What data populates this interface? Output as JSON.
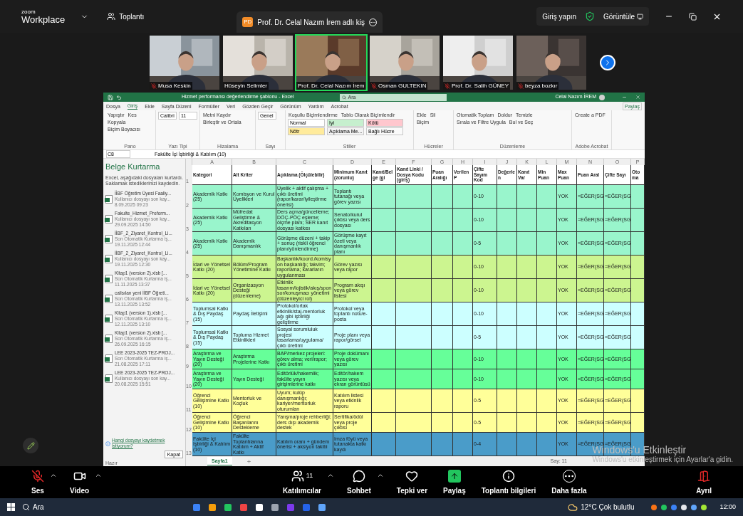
{
  "topbar": {
    "logo_top": "zoom",
    "logo_bottom": "Workplace",
    "meeting_menu": "Toplantı",
    "meeting_tab": {
      "badge": "PD",
      "title": "Prof. Dr. Celal Nazım İrem adlı kiş"
    },
    "sign_in": "Giriş yapın",
    "view": "Görüntüle"
  },
  "participants": [
    {
      "name": "Musa Keskin",
      "muted": true,
      "selected": false
    },
    {
      "name": "Hüseyin Selimler",
      "muted": false,
      "selected": false
    },
    {
      "name": "Prof. Dr. Celal Nazım İrem",
      "muted": false,
      "selected": true
    },
    {
      "name": "Osman GULTEKIN",
      "muted": true,
      "selected": false
    },
    {
      "name": "Prof. Dr. Salih GÜNEY",
      "muted": true,
      "selected": false
    },
    {
      "name": "beyza bozkır",
      "muted": true,
      "selected": false
    }
  ],
  "excel": {
    "title": "Hizmet performansı değerlendirme şablonu - Excel",
    "search": "Ara",
    "user": "Celal Nazım İREM",
    "tabs": [
      {
        "label": "Dosya",
        "selected": false
      },
      {
        "label": "Giriş",
        "selected": true
      },
      {
        "label": "Ekle",
        "selected": false
      },
      {
        "label": "Sayfa Düzeni",
        "selected": false
      },
      {
        "label": "Formüller",
        "selected": false
      },
      {
        "label": "Veri",
        "selected": false
      },
      {
        "label": "Gözden Geçir",
        "selected": false
      },
      {
        "label": "Görünüm",
        "selected": false
      },
      {
        "label": "Yardım",
        "selected": false
      },
      {
        "label": "Acrobat",
        "selected": false
      }
    ],
    "share": "Paylaş",
    "ribbon_groups": [
      {
        "name": "Pano",
        "items": [
          {
            "kind": "button",
            "label": "Yapıştır"
          },
          {
            "kind": "button",
            "label": "Kes"
          },
          {
            "kind": "button",
            "label": "Kopyala"
          },
          {
            "kind": "button",
            "label": "Biçim Boyacısı"
          }
        ]
      },
      {
        "name": "Yazı Tipi",
        "items": [
          {
            "kind": "field",
            "label": "Calibri"
          },
          {
            "kind": "field",
            "label": "11"
          }
        ]
      },
      {
        "name": "Hizalama",
        "items": [
          {
            "kind": "button",
            "label": "Metni Kaydır"
          },
          {
            "kind": "button",
            "label": "Birleştir ve Ortala"
          }
        ]
      },
      {
        "name": "Sayı",
        "items": [
          {
            "kind": "field",
            "label": "Genel"
          }
        ]
      },
      {
        "name": "Stiller",
        "items": [
          {
            "kind": "button",
            "label": "Koşullu Biçimlendirme"
          },
          {
            "kind": "button",
            "label": "Tablo Olarak Biçimlendir"
          },
          {
            "kind": "style",
            "label": "Normal",
            "color": "#ffffff"
          },
          {
            "kind": "style",
            "label": "İyi",
            "color": "#c6efce"
          },
          {
            "kind": "style",
            "label": "Kötü",
            "color": "#ffc7ce"
          },
          {
            "kind": "style",
            "label": "Nötr",
            "color": "#ffeb9c"
          },
          {
            "kind": "style",
            "label": "Açıklama Me...",
            "color": "#f2f2f2"
          },
          {
            "kind": "style",
            "label": "Bağlı Hücre",
            "color": "#fafafa"
          }
        ]
      },
      {
        "name": "Hücreler",
        "items": [
          {
            "kind": "button",
            "label": "Ekle"
          },
          {
            "kind": "button",
            "label": "Sil"
          },
          {
            "kind": "button",
            "label": "Biçim"
          }
        ]
      },
      {
        "name": "Düzenleme",
        "items": [
          {
            "kind": "button",
            "label": "Otomatik Toplam"
          },
          {
            "kind": "button",
            "label": "Doldur"
          },
          {
            "kind": "button",
            "label": "Temizle"
          },
          {
            "kind": "button",
            "label": "Sırala ve Filtre Uygula"
          },
          {
            "kind": "button",
            "label": "Bul ve Seç"
          }
        ]
      },
      {
        "name": "Adobe Acrobat",
        "items": [
          {
            "kind": "button",
            "label": "Create a PDF"
          }
        ]
      }
    ],
    "name_box": "C8",
    "formula": "Fakülte İçi İşbirliği & Katılım (10)",
    "recovery": {
      "title": "Belge Kurtarma",
      "intro": "Excel, aşağıdaki dosyaları kurtardı. Saklamak istediklerinizi kaydedin.",
      "files": [
        {
          "name": "İİBF Öğretim Üyesi Faaliy...",
          "status": "Kullanıcı dosyayı son kay...",
          "date": "8.09.2025 09:23"
        },
        {
          "name": "Fakulte_Hizmet_Preform...",
          "status": "Kullanıcı dosyayı son kay...",
          "date": "29.09.2025 14:50"
        },
        {
          "name": "İİBF_2_Ziyaret_Kontrol_Li...",
          "status": "Son Otomatik Kurtarma iş...",
          "date": "19.11.2025 12:44"
        },
        {
          "name": "İİBF_2_Ziyaret_Kontrol_Li...",
          "status": "Kullanıcı dosyayı son kay...",
          "date": "19.11.2025 12:30"
        },
        {
          "name": "Kitap1 (version 2).xlsb [...",
          "status": "Son Otomatik Kurtarma iş...",
          "date": "11.11.2025 13:37"
        },
        {
          "name": "calisılan yeni İİBF Öğreti...",
          "status": "Son Otomatik Kurtarma iş...",
          "date": "13.11.2025 13:52"
        },
        {
          "name": "Kitap1 (version 1).xlsb [...",
          "status": "Son Otomatik Kurtarma iş...",
          "date": "12.11.2025 13:10"
        },
        {
          "name": "Kitap1 (version 2).xlsb [...",
          "status": "Son Otomatik Kurtarma iş...",
          "date": "26.09.2025 16:15"
        },
        {
          "name": "LEE 2023-2025 TEZ-PROJ...",
          "status": "Son Otomatik Kurtarma iş...",
          "date": "21.08.2025 17:11"
        },
        {
          "name": "LEE 2023-2025 TEZ-PROJ...",
          "status": "Kullanıcı dosyayı son kay...",
          "date": "20.08.2025 15:51"
        }
      ],
      "link": "Hangi dosyayı kaydetmek istiyorum?",
      "close": "Kapat"
    },
    "column_letters": [
      "A",
      "B",
      "C",
      "D",
      "E",
      "F",
      "G",
      "H",
      "I",
      "J",
      "K",
      "L",
      "M",
      "N",
      "O",
      "P"
    ],
    "header": {
      "row_number": "1",
      "cells": [
        "Kategori",
        "Alt Kriter",
        "Açıklama (Ölçülebilir)",
        "Minimum Kanıt (zorunlu)",
        "Kanıt/Belge (gi",
        "Kanıt Linki / Dosya Kodu (giriş)",
        "Puan Aralığı",
        "Verilen P",
        "Çifte Sayım Kod",
        "Değerlen",
        "Kanıt Var",
        "Min Puan",
        "Max Puan",
        "Puan Aral",
        "Çifte Sayı",
        "Otoma"
      ]
    },
    "rows": [
      {
        "row_number": "2",
        "color": "#99f5cc",
        "category": "Akademik Katkı (25)",
        "criterion": "Komisyon ve Kurul Üyelikleri",
        "description": "Üyelik + aktif çalışma + çıktı üretimi (rapor/karar/iyileştirme önerisi)",
        "evidence": "Toplantı tutanağı veya görev yazısı",
        "range": "0-10",
        "max": "YOK",
        "formula_n": "=EĞER(SG",
        "formula_o": "=EĞER(SG"
      },
      {
        "row_number": "3",
        "color": "#99f5cc",
        "category": "Akademik Katkı (25)",
        "criterion": "Müfredat Geliştirme & Akreditasyon Katkıları",
        "description": "Ders açma/güncelleme; DÖÇ-PÖÇ eşleme; ölçme planı; SER kanıt dosyası katkısı",
        "evidence": "Senato/kurul çıktısı veya ders dosyası",
        "range": "0-10",
        "max": "YOK",
        "formula_n": "=EĞER(SG",
        "formula_o": "=EĞER(SG"
      },
      {
        "row_number": "4",
        "color": "#99f5cc",
        "category": "Akademik Katkı (25)",
        "criterion": "Akademik Danışmanlık",
        "description": "Görüşme düzeni + takip + sonuç (riskli öğrenci planı/yönlendirme)",
        "evidence": "Görüşme kayıt özeti veya danışmanlık planı",
        "range": "0-5",
        "max": "YOK",
        "formula_n": "=EĞER(SG",
        "formula_o": "=EĞER(SG"
      },
      {
        "row_number": "5",
        "color": "#ccf590",
        "category": "İdari ve Yönetsel Katkı (20)",
        "criterion": "Bölüm/Program Yönetimine Katkı",
        "description": "Başkanlık/koord./komisyon başkanlığı; takvim; raporlama; kararların uygulanması",
        "evidence": "Görev yazısı veya rapor",
        "range": "0-10",
        "max": "YOK",
        "formula_n": "=EĞER(SG",
        "formula_o": "=EĞER(SG"
      },
      {
        "row_number": "6",
        "color": "#ccf590",
        "category": "İdari ve Yönetsel Katkı (20)",
        "criterion": "Organizasyon Desteği (düzenleme)",
        "description": "Etkinlik tasarım/lojistik/akış/sponsor/konuşmacı yönetimi (düzenleyici rol)",
        "evidence": "Program akışı veya görev listesi",
        "range": "0-10",
        "max": "YOK",
        "formula_n": "=EĞER(SG",
        "formula_o": "=EĞER(SG"
      },
      {
        "row_number": "7",
        "color": "#ccffff",
        "category": "Toplumsal Katkı & Dış Paydaş (15)",
        "criterion": "Paydaş İletişimi",
        "description": "Protokol/ortak etkinlik/staj-mentorluk ağı gibi işbirliği geliştirme",
        "evidence": "Protokol veya toplantı notu/e-posta",
        "range": "0-10",
        "max": "YOK",
        "formula_n": "=EĞER(SG",
        "formula_o": "=EĞER(SG"
      },
      {
        "row_number": "8",
        "color": "#ccffff",
        "category": "Toplumsal Katkı & Dış Paydaş (15)",
        "criterion": "Topluma Hizmet Etkinlikleri",
        "description": "Sosyal sorumluluk projesi tasarlama/uygulama/çıktı üretimi",
        "evidence": "Proje planı veya rapor/görsel",
        "range": "0-5",
        "max": "YOK",
        "formula_n": "=EĞER(SG",
        "formula_o": "=EĞER(SG"
      },
      {
        "row_number": "9",
        "color": "#66ff99",
        "category": "Araştırma ve Yayın Desteği (20)",
        "criterion": "Araştırma Projelerine Katkı",
        "description": "BAP/merkez projeleri: görev alma; veri/rapor; çıktı üretimi",
        "evidence": "Proje dokümanı veya görev yazısı",
        "range": "0-10",
        "max": "YOK",
        "formula_n": "=EĞER(SG",
        "formula_o": "=EĞER(SG"
      },
      {
        "row_number": "10",
        "color": "#66ff99",
        "category": "Araştırma ve Yayın Desteği (20)",
        "criterion": "Yayın Desteği",
        "description": "Editörlük/hakemlik; fakülte yayın girişimlerine katkı",
        "evidence": "Editör/hakem yazısı veya ekran görüntüsü",
        "range": "0-10",
        "max": "YOK",
        "formula_n": "=EĞER(SG",
        "formula_o": "=EĞER(SG"
      },
      {
        "row_number": "11",
        "color": "#ffff99",
        "category": "Öğrenci Gelişimine Katkı (10)",
        "criterion": "Mentorluk ve Koçluk",
        "description": "Uyum; kulüp danışmanlığı; kariyer/mentorluk oturumları",
        "evidence": "Katılım listesi veya etkinlik raporu",
        "range": "0-5",
        "max": "YOK",
        "formula_n": "=EĞER(SG",
        "formula_o": "=EĞER(SG"
      },
      {
        "row_number": "12",
        "color": "#ffff99",
        "category": "Öğrenci Gelişimine Katkı (10)",
        "criterion": "Öğrenci Başarılarını Destekleme",
        "description": "Yarışma/proje rehberliği; ders dışı akademik destek",
        "evidence": "Sertifika/ödül veya proje çıktısı",
        "range": "0-5",
        "max": "YOK",
        "formula_n": "=EĞER(SG",
        "formula_o": "=EĞER(SG"
      },
      {
        "row_number": "13",
        "color": "#4a9cc9",
        "category": "Fakülte İçi İşbirliği & Katılım (10)",
        "criterion": "Fakülte Toplantılarına Katılım + Aktif Katkı",
        "description": "Katılım oranı + gündem önerisi + aksiyon takibi",
        "evidence": "İmza föyü veya tutanakta katkı kaydı",
        "range": "0-4",
        "max": "YOK",
        "formula_n": "=EĞER(SG",
        "formula_o": "=EĞER(SG"
      }
    ],
    "sheet_tabs": [
      {
        "label": "Sayfa1",
        "selected": true
      }
    ],
    "status": "Hazır",
    "count": "Say: 11"
  },
  "activation": {
    "title": "Windows'u Etkinleştir",
    "hint": "Windows'u etkinleştirmek için Ayarlar'a gidin."
  },
  "toolbar": [
    {
      "kind": "audio",
      "label": "Ses",
      "muted": true
    },
    {
      "kind": "video",
      "label": "Video"
    },
    {
      "kind": "participants",
      "label": "Katılımcılar",
      "count": "11"
    },
    {
      "kind": "chat",
      "label": "Sohbet"
    },
    {
      "kind": "react",
      "label": "Tepki ver"
    },
    {
      "kind": "share",
      "label": "Paylaş"
    },
    {
      "kind": "info",
      "label": "Toplantı bilgileri"
    },
    {
      "kind": "more",
      "label": "Daha fazla"
    },
    {
      "kind": "leave",
      "label": "Ayrıl"
    }
  ],
  "taskbar": {
    "search": "Ara",
    "weather": "12°C Çok bulutlu",
    "time": "12:00"
  }
}
